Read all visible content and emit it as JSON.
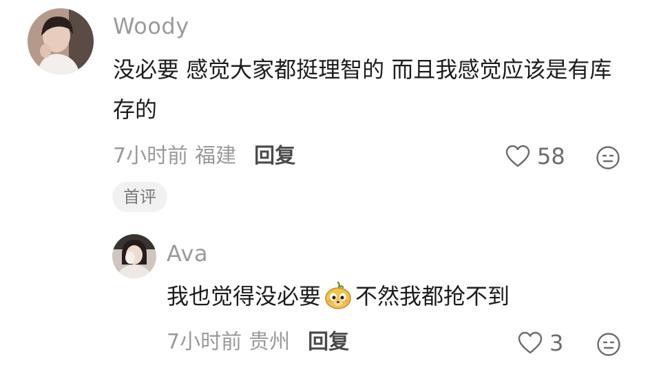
{
  "comment": {
    "username": "Woody",
    "content": "没必要 感觉大家都挺理智的 而且我感觉应该是有库存的",
    "time": "7小时前",
    "location": "福建",
    "reply_label": "回复",
    "like_count": "58",
    "badge": "首评"
  },
  "reply": {
    "username": "Ava",
    "content_before": "我也觉得没必要",
    "content_after": "不然我都抢不到",
    "time": "7小时前",
    "location": "贵州",
    "reply_label": "回复",
    "like_count": "3"
  },
  "icons": {
    "like": "heart-icon",
    "dislike": "meh-face-icon",
    "emoji": "dog-face-emoji"
  },
  "colors": {
    "muted_text": "#9a9a9a",
    "body_text": "#1c1c1c",
    "badge_bg": "#f1f1f1"
  }
}
